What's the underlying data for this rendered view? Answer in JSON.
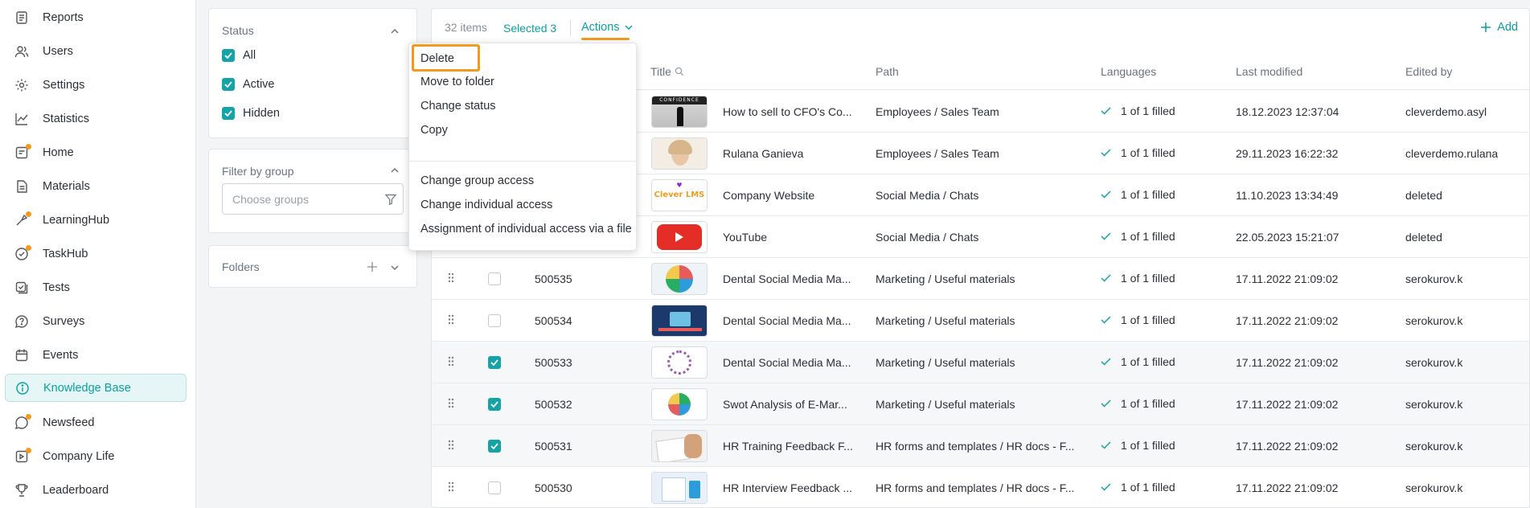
{
  "sidebar": {
    "items": [
      {
        "label": "Reports",
        "icon": "reports-icon"
      },
      {
        "label": "Users",
        "icon": "users-icon"
      },
      {
        "label": "Settings",
        "icon": "gear-icon"
      },
      {
        "label": "Statistics",
        "icon": "statistics-icon"
      },
      {
        "label": "Home",
        "icon": "home-icon"
      },
      {
        "label": "Materials",
        "icon": "materials-icon"
      },
      {
        "label": "LearningHub",
        "icon": "learninghub-icon"
      },
      {
        "label": "TaskHub",
        "icon": "taskhub-icon"
      },
      {
        "label": "Tests",
        "icon": "tests-icon"
      },
      {
        "label": "Surveys",
        "icon": "surveys-icon"
      },
      {
        "label": "Events",
        "icon": "events-icon"
      },
      {
        "label": "Knowledge Base",
        "icon": "info-icon"
      },
      {
        "label": "Newsfeed",
        "icon": "newsfeed-icon"
      },
      {
        "label": "Company Life",
        "icon": "company-life-icon"
      },
      {
        "label": "Leaderboard",
        "icon": "trophy-icon"
      }
    ],
    "active_index": 11
  },
  "filters": {
    "status": {
      "title": "Status",
      "options": [
        {
          "label": "All",
          "checked": true
        },
        {
          "label": "Active",
          "checked": true
        },
        {
          "label": "Hidden",
          "checked": true
        }
      ]
    },
    "group": {
      "title": "Filter by group",
      "placeholder": "Choose groups"
    },
    "folders": {
      "title": "Folders"
    }
  },
  "toolbar": {
    "count": "32 items",
    "selected": "Selected 3",
    "actions": "Actions",
    "add": "Add"
  },
  "actions_menu": {
    "items_top": [
      "Delete",
      "Move to folder",
      "Change status",
      "Copy"
    ],
    "items_bottom": [
      "Change group access",
      "Change individual access",
      "Assignment of individual access via a file"
    ]
  },
  "table": {
    "columns": {
      "title": "Title",
      "path": "Path",
      "languages": "Languages",
      "modified": "Last modified",
      "edited": "Edited by"
    },
    "rows": [
      {
        "id": "",
        "checked": null,
        "thumb": "CONFIDENCE",
        "title": "How to sell to CFO's Co...",
        "path": "Employees / Sales Team",
        "lang": "1 of 1 filled",
        "modified": "18.12.2023 12:37:04",
        "edited": "cleverdemo.asyl"
      },
      {
        "id": "",
        "checked": null,
        "thumb": "",
        "title": "Rulana Ganieva",
        "path": "Employees / Sales Team",
        "lang": "1 of 1 filled",
        "modified": "29.11.2023 16:22:32",
        "edited": "cleverdemo.rulana"
      },
      {
        "id": "",
        "checked": null,
        "thumb": "Clever LMS",
        "title": "Company Website",
        "path": "Social Media / Chats",
        "lang": "1 of 1 filled",
        "modified": "11.10.2023 13:34:49",
        "edited": "deleted"
      },
      {
        "id": "",
        "checked": null,
        "thumb": "",
        "title": "YouTube",
        "path": "Social Media / Chats",
        "lang": "1 of 1 filled",
        "modified": "22.05.2023 15:21:07",
        "edited": "deleted"
      },
      {
        "id": "500535",
        "checked": false,
        "thumb": "",
        "title": "Dental Social Media Ma...",
        "path": "Marketing / Useful materials",
        "lang": "1 of 1 filled",
        "modified": "17.11.2022 21:09:02",
        "edited": "serokurov.k"
      },
      {
        "id": "500534",
        "checked": false,
        "thumb": "",
        "title": "Dental Social Media Ma...",
        "path": "Marketing / Useful materials",
        "lang": "1 of 1 filled",
        "modified": "17.11.2022 21:09:02",
        "edited": "serokurov.k"
      },
      {
        "id": "500533",
        "checked": true,
        "thumb": "",
        "title": "Dental Social Media Ma...",
        "path": "Marketing / Useful materials",
        "lang": "1 of 1 filled",
        "modified": "17.11.2022 21:09:02",
        "edited": "serokurov.k"
      },
      {
        "id": "500532",
        "checked": true,
        "thumb": "",
        "title": "Swot Analysis of E-Mar...",
        "path": "Marketing / Useful materials",
        "lang": "1 of 1 filled",
        "modified": "17.11.2022 21:09:02",
        "edited": "serokurov.k"
      },
      {
        "id": "500531",
        "checked": true,
        "thumb": "",
        "title": "HR Training Feedback F...",
        "path": "HR forms and templates / HR docs - F...",
        "lang": "1 of 1 filled",
        "modified": "17.11.2022 21:09:02",
        "edited": "serokurov.k"
      },
      {
        "id": "500530",
        "checked": false,
        "thumb": "",
        "title": "HR Interview Feedback ...",
        "path": "HR forms and templates / HR docs - F...",
        "lang": "1 of 1 filled",
        "modified": "17.11.2022 21:09:02",
        "edited": "serokurov.k"
      }
    ]
  },
  "colors": {
    "accent": "#14a3a6",
    "highlight": "#f39a1e"
  }
}
